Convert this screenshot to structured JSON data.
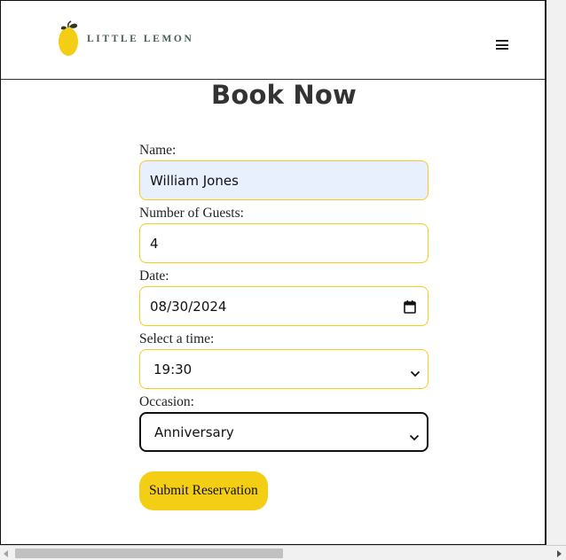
{
  "header": {
    "brand_name": "LITTLE LEMON",
    "menu_icon": "hamburger-menu-icon",
    "logo_icon": "lemon-icon"
  },
  "page": {
    "title": "Book Now"
  },
  "form": {
    "name": {
      "label": "Name:",
      "value": "William Jones"
    },
    "guests": {
      "label": "Number of Guests:",
      "value": "4"
    },
    "date": {
      "label": "Date:",
      "value": "08/30/2024",
      "icon": "calendar-icon"
    },
    "time": {
      "label": "Select a time:",
      "value": "19:30"
    },
    "occasion": {
      "label": "Occasion:",
      "value": "Anniversary"
    },
    "submit_label": "Submit Reservation"
  },
  "colors": {
    "accent_yellow": "#f4ce14",
    "brand_green": "#495e57",
    "autofill_bg": "#e8f0fe"
  }
}
